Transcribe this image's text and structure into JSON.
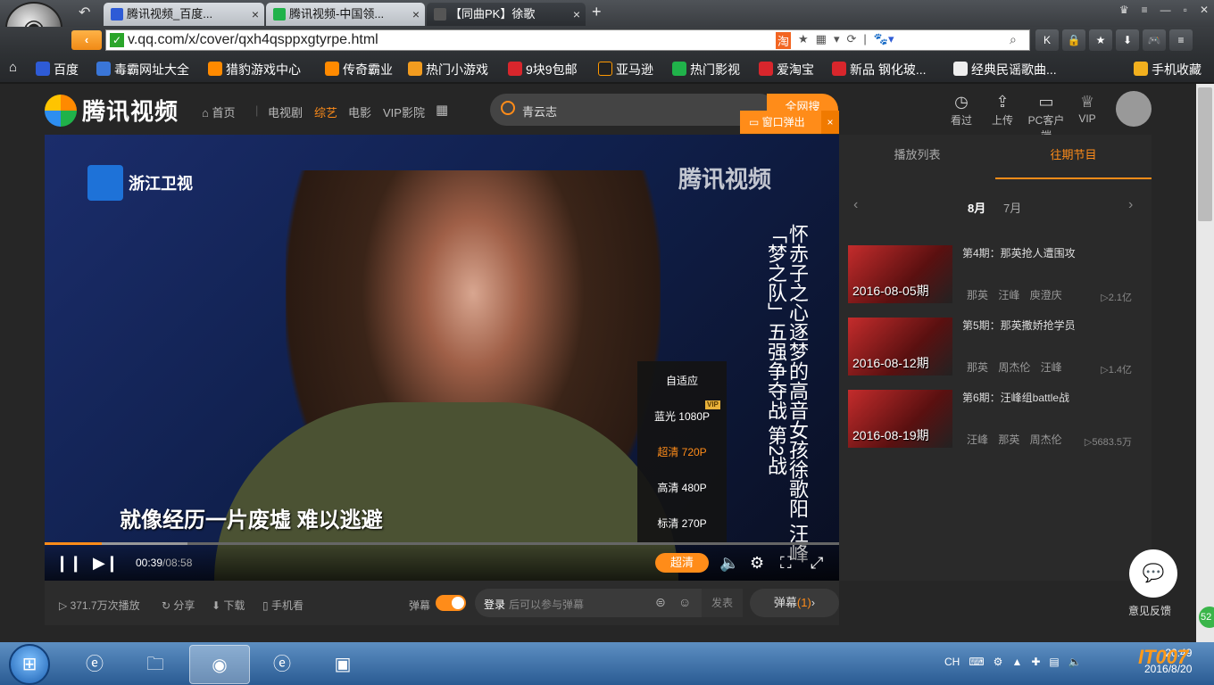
{
  "browser": {
    "tabs": [
      {
        "label": "腾讯视频_百度...",
        "icon": "baidu-icon"
      },
      {
        "label": "腾讯视频-中国领...",
        "icon": "tencent-video-icon"
      },
      {
        "label": "【同曲PK】徐歌",
        "icon": "video-icon"
      }
    ],
    "new_tab": "+",
    "url": "v.qq.com/x/cover/qxh4qsppxgtyrpe.html",
    "bookmarks": [
      "百度",
      "毒霸网址大全",
      "猎豹游戏中心",
      "传奇霸业",
      "热门小游戏",
      "9块9包邮",
      "亚马逊",
      "热门影视",
      "爱淘宝",
      "新品 钢化玻...",
      "经典民谣歌曲...",
      "手机收藏"
    ]
  },
  "site": {
    "logo_text": "腾讯视频",
    "nav": [
      "首页",
      "电视剧",
      "综艺",
      "电影",
      "VIP影院"
    ],
    "search_value": "青云志",
    "search_button": "全网搜",
    "popout": "窗口弹出",
    "toolbar": [
      {
        "label": "看过",
        "icon": "clock-icon"
      },
      {
        "label": "上传",
        "icon": "upload-icon"
      },
      {
        "label": "PC客户端",
        "icon": "monitor-icon"
      },
      {
        "label": "VIP",
        "icon": "vip-icon"
      }
    ]
  },
  "player": {
    "channel": "浙江卫视",
    "watermark": "腾讯视频",
    "overlay_vertical": "怀赤子之心逐梦的高音女孩徐歌阳 汪峰「梦之队」五强争夺战 第2战",
    "subtitle": "就像经历一片废墟  难以逃避",
    "quality_options": [
      "自适应",
      "蓝光 1080P",
      "超清 720P",
      "高清 480P",
      "标清 270P"
    ],
    "selected_quality": "超清",
    "vip_badge": "VIP",
    "time_current": "00:39",
    "time_total": "/08:58",
    "progress": 0.072
  },
  "below": {
    "plays": "371.7万次播放",
    "share": "分享",
    "download": "下载",
    "mobile": "手机看",
    "danmu_label": "弹幕",
    "login": "登录",
    "danmu_placeholder": "后可以参与弹幕",
    "send": "发表",
    "danmu_btn": "弹幕",
    "danmu_count": "(1)"
  },
  "sidebar": {
    "tabs": [
      "播放列表",
      "往期节目"
    ],
    "months": [
      "8月",
      "7月"
    ],
    "episodes": [
      {
        "title": "第4期：那英抢人遭围攻",
        "date": "2016-08-05期",
        "tags": "那英 汪峰 庾澄庆",
        "views": "2.1亿"
      },
      {
        "title": "第5期：那英撒娇抢学员",
        "date": "2016-08-12期",
        "tags": "那英 周杰伦 汪峰",
        "views": "1.4亿"
      },
      {
        "title": "第6期：汪峰组battle战",
        "date": "2016-08-19期",
        "tags": "汪峰 那英 周杰伦",
        "views": "5683.5万"
      }
    ]
  },
  "feedback": "意见反馈",
  "side_badge": "52",
  "taskbar": {
    "tray_lang": "CH",
    "time": "20:49",
    "date": "2016/8/20",
    "brand": "IT007"
  }
}
